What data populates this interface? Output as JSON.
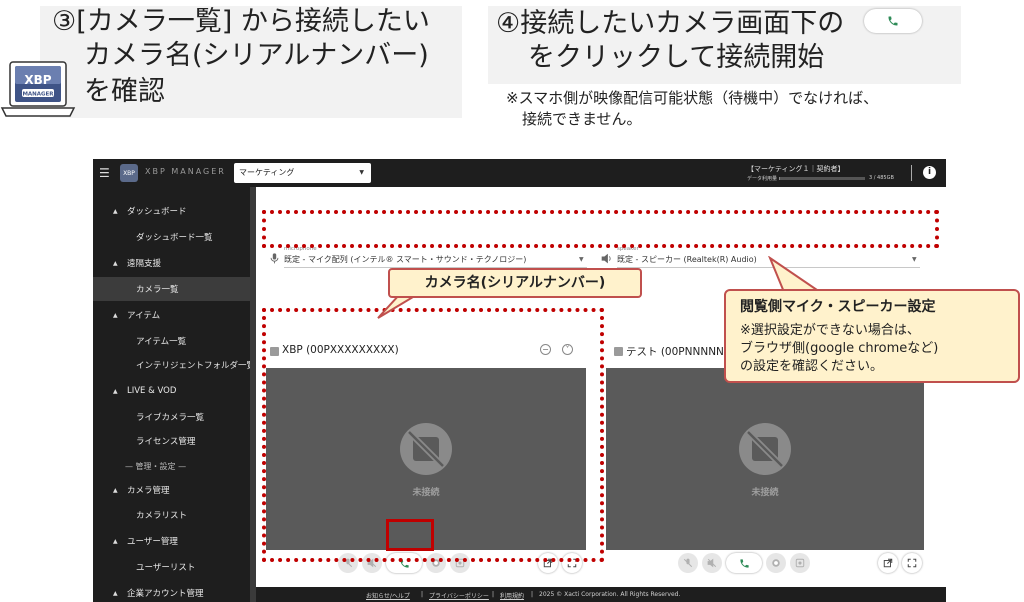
{
  "instructions": {
    "step3": {
      "line1": "③[カメラ一覧] から接続したい",
      "line2": "カメラ名(シリアルナンバー)",
      "line3": "を確認"
    },
    "step4": {
      "line1": "④接続したいカメラ画面下の",
      "line2": "をクリックして接続開始",
      "note1": "※スマホ側が映像配信可能状態（待機中）でなければ、",
      "note2": "接続できません。"
    }
  },
  "logo": {
    "text_top": "XBP",
    "text_bottom": "MANAGER"
  },
  "topbar": {
    "app_title": "XBP MANAGER",
    "logo_text": "XBP",
    "org_select": "マーケティング",
    "contract": "【マーケティング１｜契約者】",
    "usage_label": "データ利用量",
    "usage_value": "3 / 485GB",
    "usage_fraction": 0.01,
    "info_glyph": "i"
  },
  "sidebar": {
    "items": [
      {
        "label": "ダッシュボード",
        "kind": "top"
      },
      {
        "label": "ダッシュボード一覧",
        "kind": "sub"
      },
      {
        "label": "遠隔支援",
        "kind": "top"
      },
      {
        "label": "カメラ一覧",
        "kind": "sub",
        "active": true
      },
      {
        "label": "アイテム",
        "kind": "top"
      },
      {
        "label": "アイテム一覧",
        "kind": "sub"
      },
      {
        "label": "インテリジェントフォルダ一覧",
        "kind": "sub"
      },
      {
        "label": "LIVE & VOD",
        "kind": "top"
      },
      {
        "label": "ライブカメラ一覧",
        "kind": "sub"
      },
      {
        "label": "ライセンス管理",
        "kind": "sub"
      },
      {
        "label": "管理・設定",
        "kind": "divider"
      },
      {
        "label": "カメラ管理",
        "kind": "top"
      },
      {
        "label": "カメラリスト",
        "kind": "sub"
      },
      {
        "label": "ユーザー管理",
        "kind": "top"
      },
      {
        "label": "ユーザーリスト",
        "kind": "sub"
      },
      {
        "label": "企業アカウント管理",
        "kind": "top"
      }
    ]
  },
  "devices": {
    "mic_label": "microphone",
    "mic_value": "既定 - マイク配列 (インテル® スマート・サウンド・テクノロジー)",
    "speaker_label": "speaker",
    "speaker_value": "既定 - スピーカー (Realtek(R) Audio)"
  },
  "cameras": [
    {
      "name": "XBP (00PXXXXXXXXX)",
      "status": "未接続"
    },
    {
      "name": "テスト (00PNNNNNNNNN)",
      "status": "未接続"
    }
  ],
  "footer": {
    "help": "お知らせ/ヘルプ",
    "privacy": "プライバシーポリシー",
    "terms": "利用規約",
    "sep": "|",
    "copyright": "2025 © Xacti Corporation. All Rights Reserved."
  },
  "callouts": {
    "camera_name": "カメラ名(シリアルナンバー)",
    "settings_title": "閲覧側マイク・スピーカー設定",
    "settings_line1": "※選択設定ができない場合は、",
    "settings_line2": "ブラウザ側(google chromeなど)",
    "settings_line3": "の設定を確認ください。"
  },
  "colors": {
    "annotation_red": "#c00000",
    "callout_fill": "#fff2cc",
    "call_green": "#2e8b57",
    "app_dark": "#1e1e1e"
  }
}
